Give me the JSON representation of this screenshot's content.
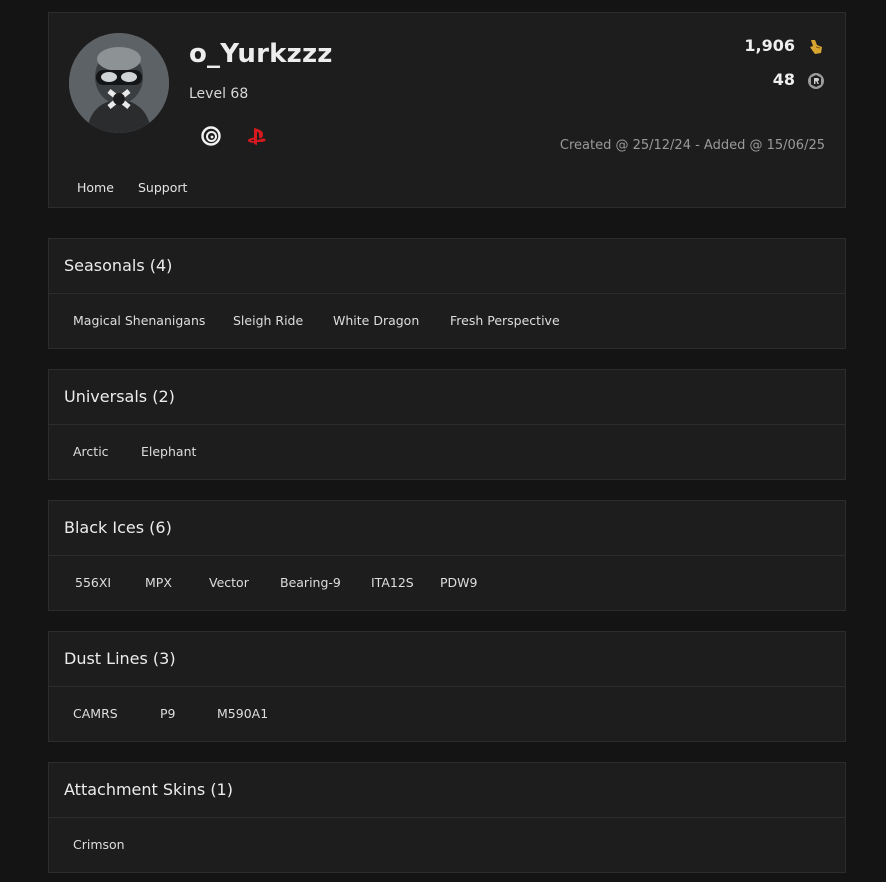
{
  "profile": {
    "username": "o_Yurkzzz",
    "level": "Level 68",
    "platforms": [
      "ubisoft-icon",
      "playstation-icon"
    ],
    "renown": "1,906",
    "credits": "48",
    "dates": "Created @ 25/12/24 - Added @ 15/06/25",
    "accent_renown": "#d8a531",
    "accent_psn": "#d6191f"
  },
  "nav": {
    "home": "Home",
    "support": "Support"
  },
  "sections": [
    {
      "title": "Seasonals (4)",
      "items": [
        "Magical Shenanigans",
        "Sleigh Ride",
        "White Dragon",
        "Fresh Perspective"
      ]
    },
    {
      "title": "Universals (2)",
      "items": [
        "Arctic",
        "Elephant"
      ]
    },
    {
      "title": "Black Ices (6)",
      "items": [
        "556XI",
        "MPX",
        "Vector",
        "Bearing-9",
        "ITA12S",
        "PDW9"
      ]
    },
    {
      "title": "Dust Lines (3)",
      "items": [
        "CAMRS",
        "P9",
        "M590A1"
      ]
    },
    {
      "title": "Attachment Skins (1)",
      "items": [
        "Crimson"
      ]
    }
  ]
}
